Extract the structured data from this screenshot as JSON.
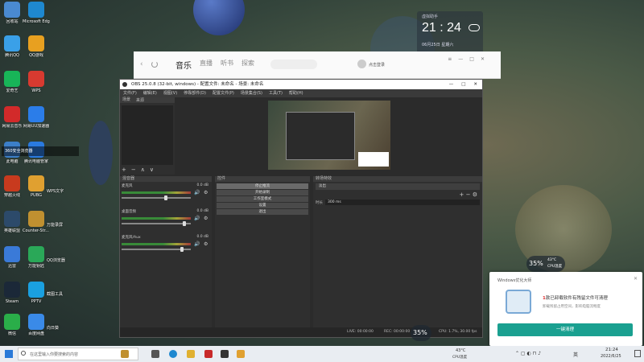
{
  "desktop": {
    "icons": [
      {
        "label": "回收站",
        "color": "#4a8ad0"
      },
      {
        "label": "腾讯QQ",
        "color": "#3aa0e8"
      },
      {
        "label": "爱奇艺",
        "color": "#18b558"
      },
      {
        "label": "网易云音乐",
        "color": "#d22a2a"
      },
      {
        "label": "此电脑",
        "color": "#3c7fc8"
      },
      {
        "label": "穿越火线",
        "color": "#c83a1e"
      },
      {
        "label": "英雄联盟",
        "color": "#2c4a6a"
      },
      {
        "label": "迅雷",
        "color": "#3a7ad8"
      },
      {
        "label": "Steam",
        "color": "#1b2838"
      },
      {
        "label": "微信",
        "color": "#2aae49"
      },
      {
        "label": "Microsoft Edge",
        "color": "#1e88d0"
      },
      {
        "label": "QQ游戏",
        "color": "#e8a020"
      },
      {
        "label": "WPS",
        "color": "#d83a30"
      },
      {
        "label": "网易UU加速器",
        "color": "#2b7de9"
      },
      {
        "label": "腾讯电脑管家",
        "color": "#2a7ae0"
      },
      {
        "label": "PUBG",
        "color": "#e0a030"
      },
      {
        "label": "Counter-Str... Global O...",
        "color": "#c09030"
      },
      {
        "label": "万能钥匙",
        "color": "#2aa858"
      },
      {
        "label": "PPTV",
        "color": "#1aa0e0"
      },
      {
        "label": "百度网盘",
        "color": "#3a8ae8"
      }
    ],
    "blurred_label": "360安全浏览器",
    "side_labels": [
      "WPS文字",
      "万能录屏",
      "QQ浏览器",
      "截图工具",
      "向日葵"
    ]
  },
  "clock_widget": {
    "title": "虚拟助手",
    "time": "21 : 24",
    "date": "06月25日  星期六"
  },
  "music_app": {
    "tabs": [
      "音乐",
      "直播",
      "听书",
      "探索"
    ],
    "search_placeholder": "",
    "login_text": "点击登录"
  },
  "obs": {
    "title": "OBS 25.0.8 (32-bit, windows) - 配置文件: 未命名 - 场景: 未命名",
    "menu": [
      "文件(F)",
      "编辑(E)",
      "视图(V)",
      "停靠部件(D)",
      "配置文件(P)",
      "场景集合(S)",
      "工具(T)",
      "帮助(H)"
    ],
    "scenes_header": "场景",
    "sources_header": "来源",
    "mixer_header": "混音器",
    "mixer_tracks": [
      {
        "name": "麦克风",
        "db": "0.0 dB",
        "fill": 0.62
      },
      {
        "name": "桌面音频",
        "db": "0.0 dB",
        "fill": 0.88
      },
      {
        "name": "麦克风/Aux",
        "db": "0.0 dB",
        "fill": 0.85
      }
    ],
    "controls_header": "控件",
    "controls": [
      "停止推流",
      "开始录制",
      "工作室模式",
      "设置",
      "退出"
    ],
    "transitions_header": "转场特效",
    "transition_value": "淡出",
    "duration_label": "时长",
    "duration_value": "300 ms",
    "status": {
      "live": "LIVE: 00:00:00",
      "rec": "REC: 00:00:00",
      "cpu": "CPU: 1.7%, 30.00 fps"
    }
  },
  "perf_badges": [
    {
      "percent": "35%",
      "temp": "43°C",
      "note": "CPU温度"
    },
    {
      "percent": "35%",
      "temp": "",
      "note": ""
    }
  ],
  "notification": {
    "app": "Windows优化大师",
    "highlight": "1",
    "headline": "款已卸载软件有残留文件可清理",
    "sub": "卸载残留占用空间，影响电脑流畅度",
    "button": "一键清理"
  },
  "taskbar": {
    "search_placeholder": "在这里输入你要搜索的内容",
    "tray_temp": "43°C",
    "tray_temp_label": "CPU温度",
    "ime": "英",
    "time": "21:24",
    "date": "2022/6/25"
  }
}
